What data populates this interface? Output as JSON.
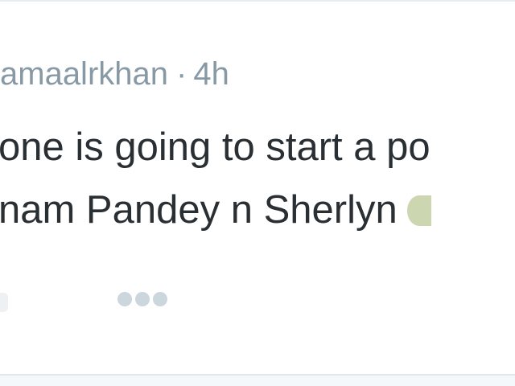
{
  "tweet": {
    "handle": "amaalrkhan",
    "separator": "·",
    "time": "4h",
    "text_lines": [
      "one is going to start a po",
      "nam Pandey n Sherlyn"
    ]
  },
  "actions": {
    "more_icon": "more-dots-icon"
  },
  "colors": {
    "meta_gray": "#8899a6",
    "text": "#292f33",
    "icon_gray": "#ccd6dd",
    "border": "#e1e8ed"
  }
}
